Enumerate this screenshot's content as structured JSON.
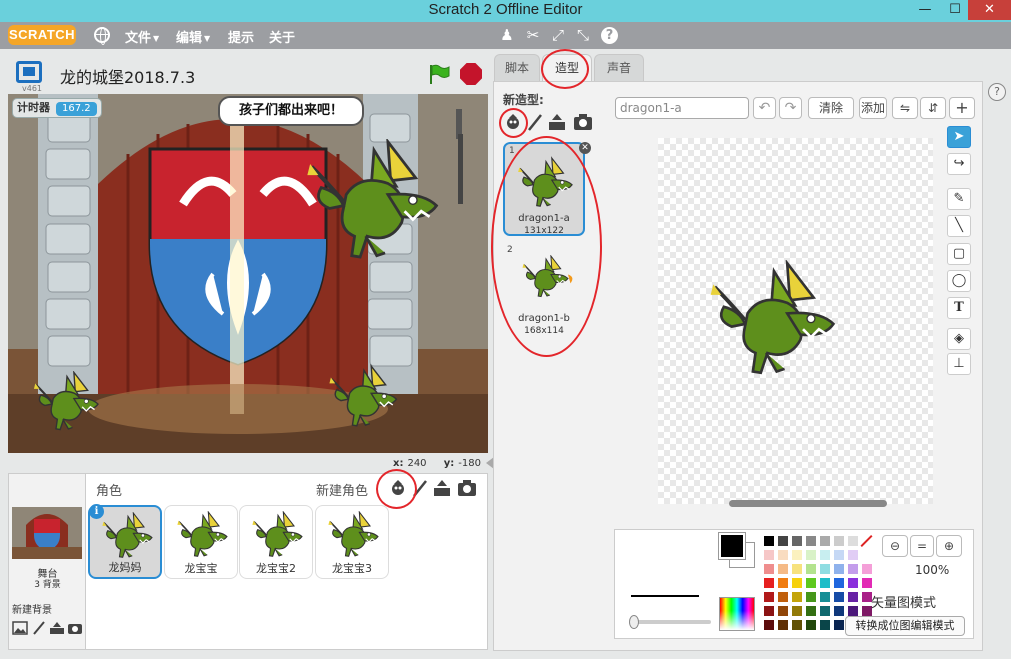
{
  "window": {
    "title": "Scratch 2 Offline Editor",
    "min": "—",
    "max": "☐",
    "close": "✕"
  },
  "menubar": {
    "logo": "SCRATCH",
    "menus": [
      {
        "label": "文件"
      },
      {
        "label": "编辑"
      },
      {
        "label": "提示"
      },
      {
        "label": "关于"
      }
    ],
    "tools": [
      "duplicate-icon",
      "cut-icon",
      "grow-icon",
      "shrink-icon",
      "help-icon"
    ]
  },
  "stage": {
    "version": "v461",
    "project_title": "龙的城堡2018.7.3",
    "timer_label": "计时器",
    "timer_value": "167.2",
    "speech": "孩子们都出来吧！",
    "x_label": "x:",
    "x_value": "240",
    "y_label": "y:",
    "y_value": "-180"
  },
  "sprite_pane": {
    "title": "角色",
    "new_sprite": "新建角色",
    "stage_name": "舞台",
    "stage_backdrops": "3 背景",
    "new_backdrop": "新建背景",
    "sprites": [
      {
        "name": "龙妈妈",
        "selected": true
      },
      {
        "name": "龙宝宝",
        "selected": false
      },
      {
        "name": "龙宝宝2",
        "selected": false
      },
      {
        "name": "龙宝宝3",
        "selected": false
      }
    ]
  },
  "tabs": [
    {
      "label": "脚本"
    },
    {
      "label": "造型"
    },
    {
      "label": "声音"
    }
  ],
  "costumes_panel": {
    "new_costume": "新造型:",
    "costumes": [
      {
        "num": "1",
        "name": "dragon1-a",
        "size": "131x122"
      },
      {
        "num": "2",
        "name": "dragon1-b",
        "size": "168x114"
      }
    ]
  },
  "editor": {
    "costume_name": "dragon1-a",
    "clear": "清除",
    "add": "添加",
    "zoom": "100%",
    "vector_mode": "矢量图模式",
    "convert": "转换成位图编辑模式"
  },
  "colors": {
    "accent": "#2a8dd4",
    "annotation_ring": "#e3262b",
    "dragon": "#5e8f1c"
  }
}
